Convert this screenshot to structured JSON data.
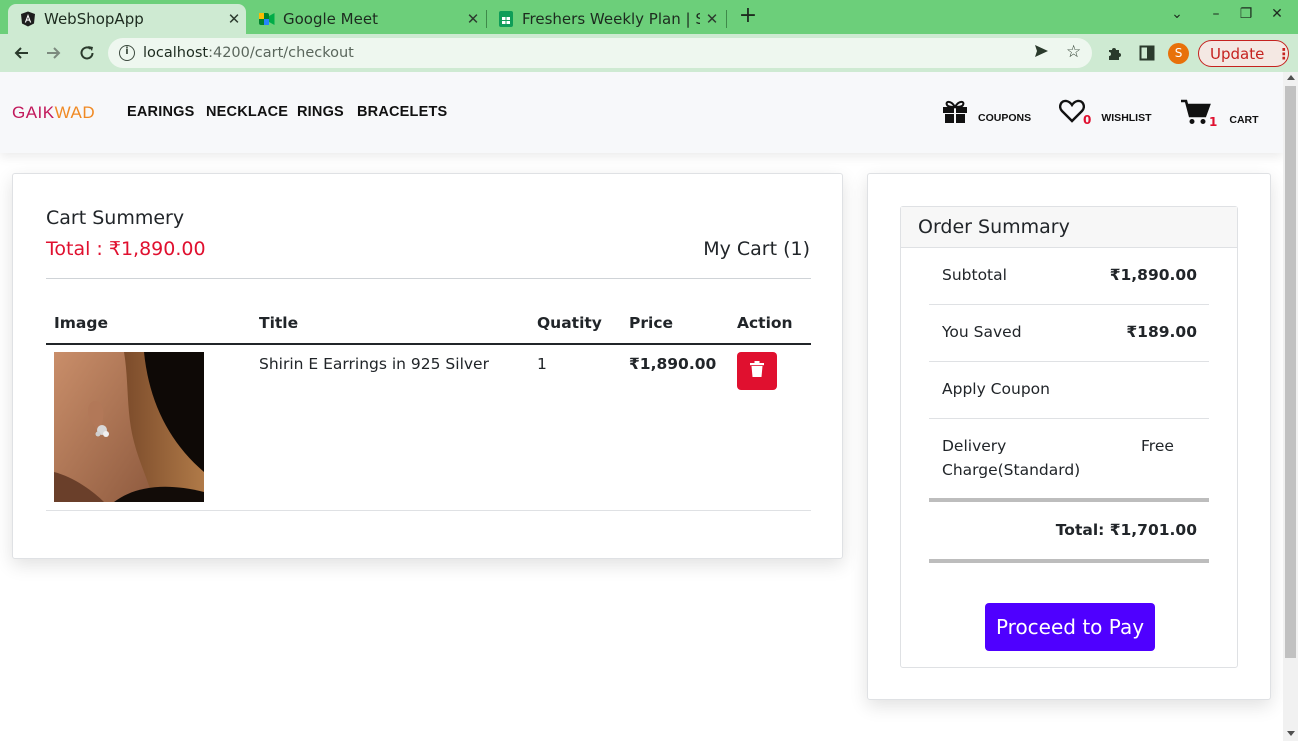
{
  "browser": {
    "tabs": [
      {
        "title": "WebShopApp",
        "icon": "angular-icon",
        "active": true
      },
      {
        "title": "Google Meet",
        "icon": "google-meet-icon",
        "active": false
      },
      {
        "title": "Freshers Weekly Plan | Sh",
        "icon": "google-sheets-icon",
        "active": false
      }
    ],
    "url_host": "localhost",
    "url_path": ":4200/cart/checkout",
    "profile_initial": "S",
    "update_label": "Update"
  },
  "nav": {
    "brand_part1": "GAIK",
    "brand_part2": "WAD",
    "links": [
      "EARINGS",
      "NECKLACE",
      "RINGS",
      "BRACELETS"
    ],
    "coupons_label": "COUPONS",
    "wishlist_label": "WISHLIST",
    "wishlist_count": "0",
    "cart_label": "CART",
    "cart_count": "1"
  },
  "cart": {
    "title": "Cart Summery",
    "total": "Total : ₹1,890.00",
    "count_label": "My Cart (1)",
    "headers": {
      "image": "Image",
      "title": "Title",
      "quantity": "Quatity",
      "price": "Price",
      "action": "Action"
    },
    "items": [
      {
        "title": "Shirin E Earrings in 925 Silver",
        "quantity": "1",
        "price": "₹1,890.00"
      }
    ]
  },
  "order_summary": {
    "title": "Order Summary",
    "subtotal_label": "Subtotal",
    "subtotal_value": "₹1,890.00",
    "saved_label": "You Saved",
    "saved_value": "₹189.00",
    "coupon_label": "Apply Coupon",
    "delivery_label_1": "Delivery",
    "delivery_label_2": "Charge(Standard)",
    "delivery_value": "Free",
    "total": "Total: ₹1,701.00",
    "pay_button": "Proceed to Pay"
  },
  "colors": {
    "accent_red": "#e0102f",
    "pay_button": "#4f00ff",
    "browser_green": "#6ccf7a"
  }
}
